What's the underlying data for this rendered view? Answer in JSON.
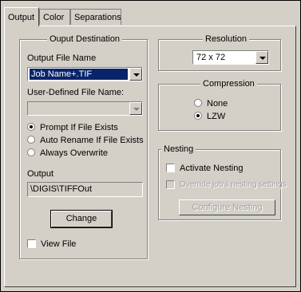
{
  "tabs": [
    "Output",
    "Color",
    "Separations"
  ],
  "output_destination": {
    "title": "Ouput Destination",
    "output_file_name_label": "Output File Name",
    "output_file_name_value": "Job Name+.TIF",
    "user_defined_label": "User-Defined File Name:",
    "user_defined_value": "",
    "radio_options": [
      "Prompt If File Exists",
      "Auto Rename If File Exists",
      "Always Overwrite"
    ],
    "radio_selected": "Prompt If File Exists",
    "output_label": "Output",
    "output_path": "\\DIGIS\\TIFFOut",
    "change_button": "Change",
    "view_file_label": "View File",
    "view_file_checked": false
  },
  "resolution": {
    "title": "Resolution",
    "value": "72 x 72"
  },
  "compression": {
    "title": "Compression",
    "options": [
      "None",
      "LZW"
    ],
    "selected": "LZW"
  },
  "nesting": {
    "title": "Nesting",
    "activate_label": "Activate Nesting",
    "activate_checked": false,
    "override_label": "Override job's nesting settings",
    "override_checked": false,
    "configure_button": "Configure Nesting"
  },
  "colors": {
    "face": "#d4d0c8",
    "selection": "#0a246a",
    "disabled_text": "#a0a0a0"
  }
}
